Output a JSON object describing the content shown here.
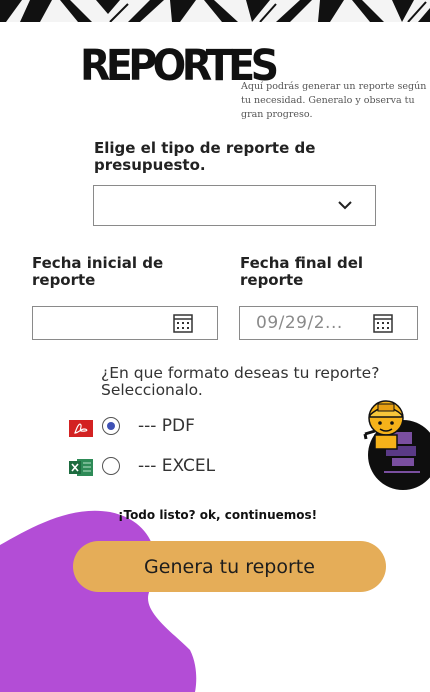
{
  "header": {
    "logo_text": "REPORTES",
    "intro_text": "Aquí podrás generar un reporte según tu necesidad. Generalo y observa tu gran progreso."
  },
  "report_type": {
    "label": "Elige el tipo de reporte de presupuesto.",
    "selected_value": ""
  },
  "start_date": {
    "label": "Fecha inicial de reporte",
    "value": ""
  },
  "end_date": {
    "label": "Fecha final del reporte",
    "value": "09/29/2..."
  },
  "format": {
    "question": "¿En que formato deseas tu reporte? Seleccionalo.",
    "options": [
      {
        "label": "--- PDF",
        "icon": "pdf-file-icon",
        "selected": true
      },
      {
        "label": "--- EXCEL",
        "icon": "excel-file-icon",
        "selected": false
      }
    ]
  },
  "ready_text": "¡Todo listo? ok, continuemos!",
  "submit_label": "Genera tu reporte",
  "colors": {
    "accent_button": "#e5ad58",
    "blob": "#b34dd6",
    "radio_selected": "#3f51b5"
  }
}
